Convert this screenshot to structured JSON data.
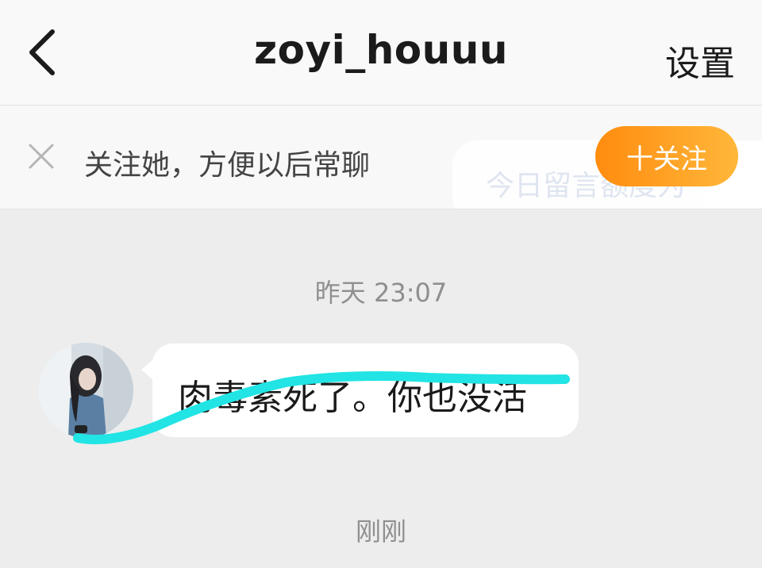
{
  "header": {
    "title": "zoyi_houuu",
    "settings_label": "设置"
  },
  "follow_prompt": {
    "text": "关注她，方便以后常聊",
    "button_label": "十关注",
    "faded_tip": "今日留言额度为"
  },
  "messages": [
    {
      "timestamp": "昨天 23:07",
      "sender": "other",
      "text": "肉毒素死了。你也没活"
    }
  ],
  "footer_timestamp": "刚刚",
  "colors": {
    "accent_start": "#ff8c0f",
    "accent_end": "#ffb73a",
    "scribble": "#22e4e4",
    "background": "#ededed"
  },
  "icons": {
    "back": "chevron-left-icon",
    "close": "close-icon"
  }
}
